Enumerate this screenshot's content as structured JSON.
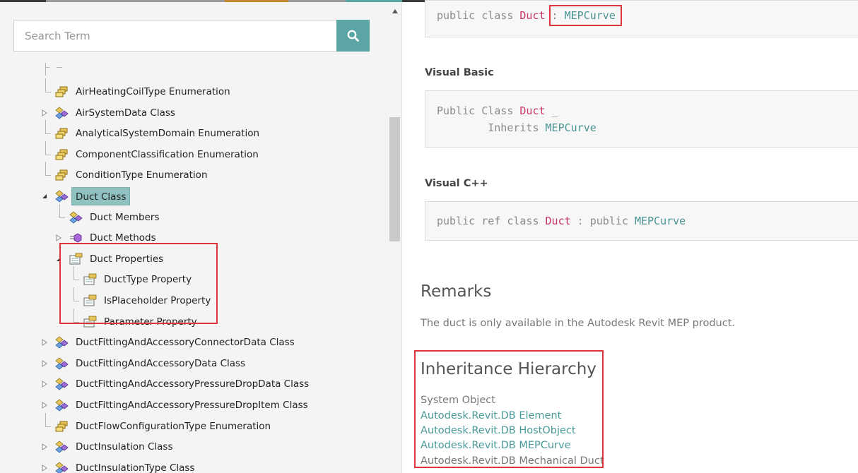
{
  "colors": {
    "accent": "#5ba5a5",
    "selected_bg": "#8fc1c1",
    "highlight_border": "#d9363e",
    "type_name": "#c8366b",
    "base_type": "#4a9494"
  },
  "search": {
    "placeholder": "Search Term",
    "button_icon": "search-icon"
  },
  "tree": {
    "items": [
      {
        "label": "AirHeatingCoilType Enumeration",
        "icon": "enumeration-icon",
        "expander": "none"
      },
      {
        "label": "AirSystemData Class",
        "icon": "class-icon",
        "expander": "collapsed"
      },
      {
        "label": "AnalyticalSystemDomain Enumeration",
        "icon": "enumeration-icon",
        "expander": "none"
      },
      {
        "label": "ComponentClassification Enumeration",
        "icon": "enumeration-icon",
        "expander": "none"
      },
      {
        "label": "ConditionType Enumeration",
        "icon": "enumeration-icon",
        "expander": "none"
      },
      {
        "label": "Duct Class",
        "icon": "class-icon",
        "expander": "expanded",
        "selected": true
      },
      {
        "label": "Duct Members",
        "icon": "class-icon",
        "expander": "none"
      },
      {
        "label": "Duct Methods",
        "icon": "method-icon",
        "expander": "collapsed"
      },
      {
        "label": "Duct Properties",
        "icon": "properties-icon",
        "expander": "expanded"
      },
      {
        "label": "DuctType Property",
        "icon": "property-icon",
        "expander": "none"
      },
      {
        "label": "IsPlaceholder Property",
        "icon": "property-icon",
        "expander": "none"
      },
      {
        "label": "Parameter Property",
        "icon": "property-icon",
        "expander": "none"
      },
      {
        "label": "DuctFittingAndAccessoryConnectorData Class",
        "icon": "class-icon",
        "expander": "collapsed"
      },
      {
        "label": "DuctFittingAndAccessoryData Class",
        "icon": "class-icon",
        "expander": "collapsed"
      },
      {
        "label": "DuctFittingAndAccessoryPressureDropData Class",
        "icon": "class-icon",
        "expander": "collapsed"
      },
      {
        "label": "DuctFittingAndAccessoryPressureDropItem Class",
        "icon": "class-icon",
        "expander": "collapsed"
      },
      {
        "label": "DuctFlowConfigurationType Enumeration",
        "icon": "enumeration-icon",
        "expander": "none"
      },
      {
        "label": "DuctInsulation Class",
        "icon": "class-icon",
        "expander": "collapsed"
      },
      {
        "label": "DuctInsulationType Class",
        "icon": "class-icon",
        "expander": "collapsed"
      }
    ]
  },
  "syntax": {
    "csharp": {
      "prefix": "public class ",
      "type": "Duct",
      "sep": " : ",
      "base": "MEPCurve"
    },
    "vb_header": "Visual Basic",
    "vb": {
      "line1_prefix": "Public Class ",
      "type": "Duct",
      "line1_suffix": " _",
      "line2_prefix": "        Inherits ",
      "base": "MEPCurve"
    },
    "cpp_header": "Visual C++",
    "cpp": {
      "prefix": "public ref class ",
      "type": "Duct",
      "sep": " : public ",
      "base": "MEPCurve"
    }
  },
  "remarks": {
    "title": "Remarks",
    "text": "The duct is only available in the Autodesk Revit MEP product."
  },
  "inheritance": {
    "title": "Inheritance Hierarchy",
    "root": "System Object",
    "links": [
      "Autodesk.Revit.DB Element",
      "Autodesk.Revit.DB HostObject",
      "Autodesk.Revit.DB MEPCurve",
      "Autodesk.Revit.DB Mechanical Duct"
    ]
  }
}
